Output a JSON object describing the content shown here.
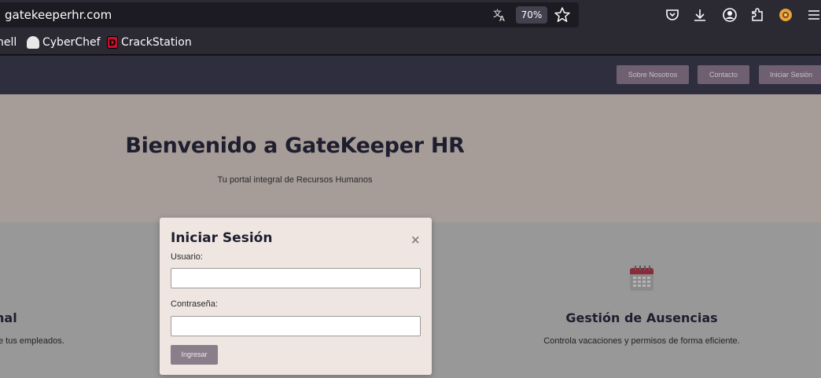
{
  "browser": {
    "url": "gatekeeperhr.com",
    "zoom": "70%",
    "translate_icon": "translate-icon",
    "star_icon": "bookmark-star-icon",
    "toolbar_icons": [
      "pocket-icon",
      "download-icon",
      "account-icon",
      "extensions-icon",
      "extension-badge-icon",
      "menu-icon"
    ]
  },
  "bookmarks": [
    {
      "label": "hell",
      "icon": ""
    },
    {
      "label": "CyberChef",
      "icon": "chef-hat-icon"
    },
    {
      "label": "CrackStation",
      "icon": "crackstation-icon"
    }
  ],
  "nav": {
    "about": "Sobre Nosotros",
    "contact": "Contacto",
    "login": "Iniciar Sesión"
  },
  "hero": {
    "title": "Bienvenido a GateKeeper HR",
    "subtitle": "Tu portal integral de Recursos Humanos"
  },
  "features": {
    "left": {
      "title": "nal",
      "desc": "e tus empleados."
    },
    "right": {
      "icon": "calendar-icon",
      "title": "Gestión de Ausencias",
      "desc": "Controla vacaciones y permisos de forma eficiente."
    }
  },
  "login_modal": {
    "title": "Iniciar Sesión",
    "close": "×",
    "username_label": "Usuario:",
    "username_value": "",
    "password_label": "Contraseña:",
    "password_value": "",
    "submit": "Ingresar"
  },
  "colors": {
    "navbar": "#2e2e3e",
    "hero_bg": "#a69c98",
    "modal_bg": "#efe6e2",
    "button": "#8a7e8a"
  }
}
